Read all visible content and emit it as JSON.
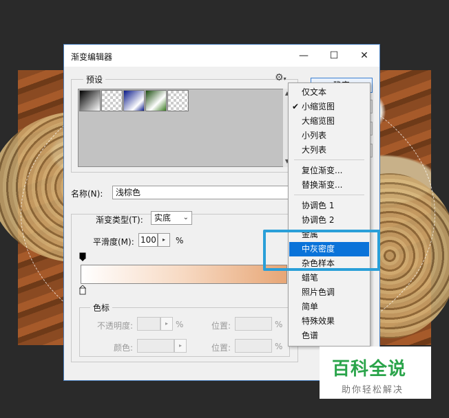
{
  "dialog": {
    "title": "渐变编辑器",
    "window_controls": {
      "minimize": "—",
      "maximize": "☐",
      "close": "✕"
    }
  },
  "presets": {
    "label": "预设",
    "menu_icon": "gear-icon"
  },
  "buttons": {
    "ok_label": "确定"
  },
  "name_field": {
    "label": "名称(N):",
    "value": "浅棕色"
  },
  "gradient_type": {
    "label": "渐变类型(T):",
    "value": "实底"
  },
  "smoothness": {
    "label": "平滑度(M):",
    "value": "100",
    "unit": "%"
  },
  "color_stops": {
    "label": "色标",
    "opacity_label": "不透明度:",
    "opacity_unit": "%",
    "color_label": "颜色:",
    "location_label": "位置:",
    "location_unit": "%"
  },
  "menu": {
    "items": [
      {
        "label": "仅文本"
      },
      {
        "label": "小缩览图",
        "checked": true
      },
      {
        "label": "大缩览图"
      },
      {
        "label": "小列表"
      },
      {
        "label": "大列表"
      },
      {
        "label": "复位渐变..."
      },
      {
        "label": "替换渐变..."
      },
      {
        "label": "协调色 1"
      },
      {
        "label": "协调色 2"
      },
      {
        "label": "金属"
      },
      {
        "label": "中灰密度",
        "selected": true
      },
      {
        "label": "杂色样本"
      },
      {
        "label": "蜡笔"
      },
      {
        "label": "照片色调"
      },
      {
        "label": "简单"
      },
      {
        "label": "特殊效果"
      },
      {
        "label": "色谱"
      }
    ],
    "check_mark": "✔"
  },
  "watermark": {
    "title": "百科全说",
    "subtitle": "助你轻松解决"
  },
  "colors": {
    "selection": "#0a73d9",
    "highlight_frame": "#2a9fd8",
    "watermark_green": "#2aa44a"
  }
}
